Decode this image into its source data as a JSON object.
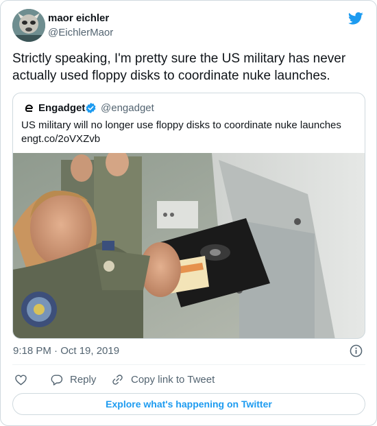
{
  "author": {
    "name": "maor eichler",
    "handle": "@EichlerMaor"
  },
  "tweet": {
    "text": "Strictly speaking, I'm pretty sure the US military has never actually used floppy disks to coordinate nuke launches."
  },
  "quoted_tweet": {
    "name": "Engadget",
    "handle": "@engadget",
    "verified_icon": "verified-badge-icon",
    "logo_icon": "engadget-logo-icon",
    "text_line1": "US military will no longer use floppy disks to coordinate nuke launches",
    "text_line2": "engt.co/2oVXZvb"
  },
  "meta": {
    "timestamp": "9:18 PM · Oct 19, 2019"
  },
  "actions": {
    "reply_label": "Reply",
    "copy_label": "Copy link to Tweet"
  },
  "footer": {
    "explore_label": "Explore what's happening on Twitter"
  },
  "colors": {
    "accent": "#1d9bf0",
    "text_primary": "#0f1419",
    "text_secondary": "#536471",
    "border": "#cfd9de"
  }
}
